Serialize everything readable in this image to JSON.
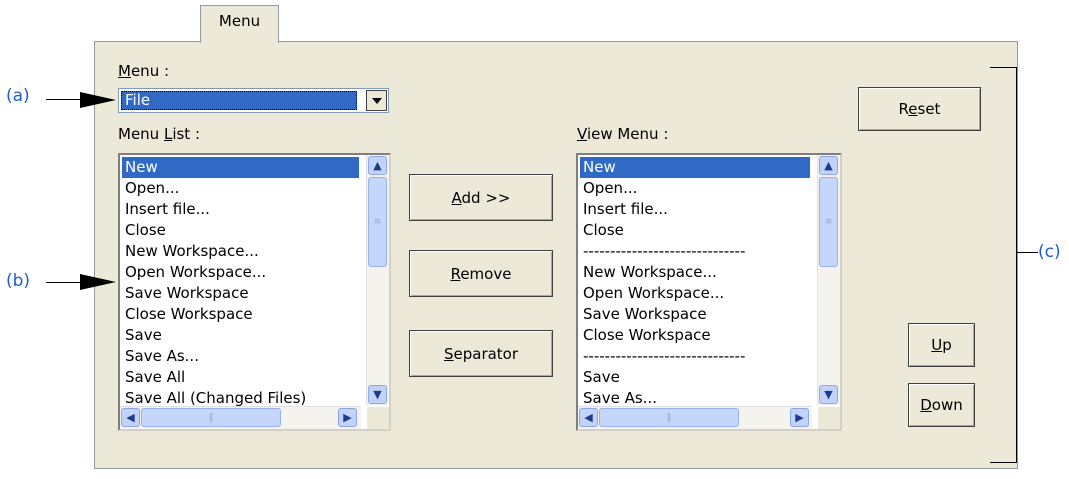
{
  "tab": {
    "label": "Menu"
  },
  "menu_label": "Menu :",
  "menu_value": "File",
  "menu_list_label": "Menu List :",
  "view_menu_label": "View Menu :",
  "buttons": {
    "reset": "Reset",
    "add": "Add >>",
    "remove": "Remove",
    "separator": "Separator",
    "up": "Up",
    "down": "Down"
  },
  "menu_list_items": [
    "New",
    "Open...",
    "Insert file...",
    "Close",
    "New Workspace...",
    "Open Workspace...",
    "Save Workspace",
    "Close Workspace",
    "Save",
    "Save As...",
    "Save All",
    "Save All (Changed Files)"
  ],
  "view_menu_items": [
    "New",
    "Open...",
    "Insert file...",
    "Close",
    "------------------------------",
    "New Workspace...",
    "Open Workspace...",
    "Save Workspace",
    "Close Workspace",
    "------------------------------",
    "Save",
    "Save As..."
  ],
  "annotations": {
    "a": "(a)",
    "b": "(b)",
    "c": "(c)"
  },
  "colors": {
    "selection": "#316ac5",
    "annotation": "#1f5bd5",
    "panel": "#ece9d8"
  }
}
